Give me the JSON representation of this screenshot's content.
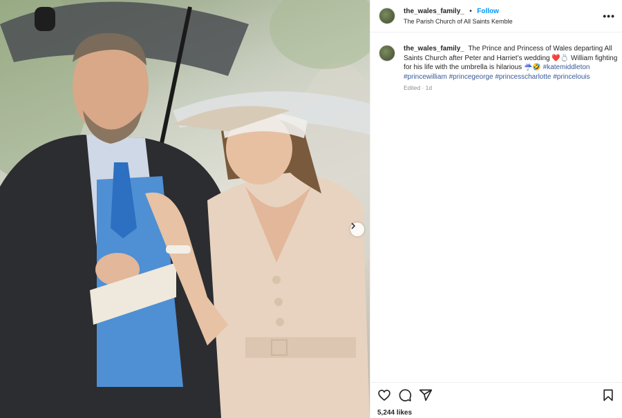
{
  "post": {
    "username": "the_wales_family_",
    "dot": "•",
    "follow_label": "Follow",
    "location": "The Parish Church of All Saints Kemble",
    "more_label": "•••",
    "caption": {
      "text": "The Prince and Princess of Wales departing All Saints Church after Peter and Harriet’s wedding ❤️💍 William fighting for his life with the umbrella is hilarious ☔🤣",
      "hashtags": [
        "#katemiddleton",
        "#princewilliam",
        "#princegeorge",
        "#princesscharlotte",
        "#princelouis"
      ]
    },
    "meta": "Edited · 1d",
    "likes": "5,244 likes"
  },
  "icons": {
    "like": "heart-icon",
    "comment": "comment-icon",
    "share": "share-icon",
    "save": "bookmark-icon",
    "next": "chevron-right-icon"
  },
  "colors": {
    "follow": "#0095f6",
    "hashtag": "#385898",
    "meta": "#8e8e8e"
  }
}
